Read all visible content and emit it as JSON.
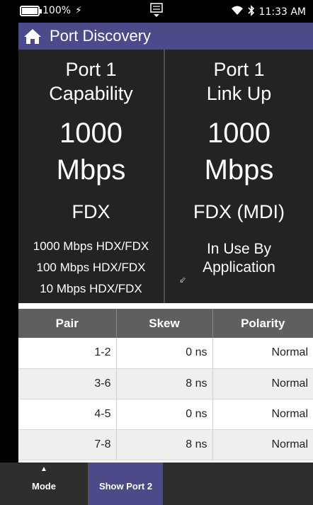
{
  "status_bar": {
    "battery_text": "100%",
    "time": "11:33 AM",
    "icons": [
      "battery-icon",
      "charging-bolt-icon",
      "keyboard-icon",
      "wifi-icon",
      "bluetooth-icon"
    ]
  },
  "title_bar": {
    "title": "Port Discovery",
    "icon": "home-icon"
  },
  "capability": {
    "line1": "Port 1",
    "line2": "Capability",
    "speed_value": "1000",
    "speed_unit": "Mbps",
    "duplex": "FDX",
    "modes": [
      "1000 Mbps HDX/FDX",
      "100 Mbps HDX/FDX",
      "10 Mbps HDX/FDX"
    ]
  },
  "link": {
    "line1": "Port 1",
    "line2": "Link Up",
    "speed_value": "1000",
    "speed_unit": "Mbps",
    "duplex": "FDX (MDI)",
    "use_line1": "In Use By",
    "use_line2": "Application"
  },
  "table": {
    "headers": [
      "Pair",
      "Skew",
      "Polarity"
    ],
    "rows": [
      {
        "pair": "1-2",
        "skew": "0 ns",
        "polarity": "Normal"
      },
      {
        "pair": "3-6",
        "skew": "8 ns",
        "polarity": "Normal"
      },
      {
        "pair": "4-5",
        "skew": "0 ns",
        "polarity": "Normal"
      },
      {
        "pair": "7-8",
        "skew": "8 ns",
        "polarity": "Normal"
      }
    ]
  },
  "bottom_bar": {
    "mode_label": "Mode",
    "show_port2_label": "Show Port 2"
  },
  "colors": {
    "accent": "#4c4a88",
    "panel_bg": "#232323",
    "table_header_bg": "#5f5f5f"
  }
}
